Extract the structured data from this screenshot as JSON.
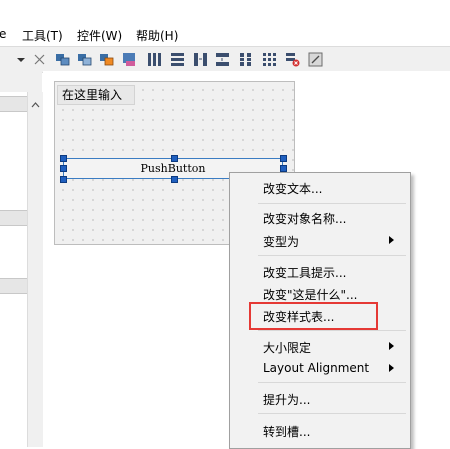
{
  "menubar": {
    "items": [
      {
        "label": "e"
      },
      {
        "label": "工具(T)"
      },
      {
        "label": "控件(W)"
      },
      {
        "label": "帮助(H)"
      }
    ]
  },
  "toolbar": {
    "icons": [
      "dropdown-arrow-icon",
      "close-icon",
      "tab-order-icon",
      "buddy-icon",
      "signals-slots-icon",
      "resource-icon",
      "layout-horizontal-icon",
      "layout-vertical-icon",
      "splitter-horizontal-icon",
      "splitter-vertical-icon",
      "form-layout-icon",
      "grid-layout-icon",
      "break-layout-icon",
      "adjust-size-icon"
    ]
  },
  "form": {
    "input_text": "在这里输入",
    "push_button_label": "PushButton"
  },
  "context_menu": {
    "items": [
      {
        "label": "改变文本..."
      },
      {
        "label": "改变对象名称..."
      },
      {
        "label": "变型为"
      },
      {
        "label": "改变工具提示..."
      },
      {
        "label": "改变\"这是什么\"..."
      },
      {
        "label": "改变样式表..."
      },
      {
        "label": "大小限定"
      },
      {
        "label": "Layout Alignment"
      },
      {
        "label": "提升为..."
      },
      {
        "label": "转到槽..."
      }
    ]
  },
  "colors": {
    "highlight_border": "#e53935",
    "selection_handle": "#1f5fbf"
  }
}
